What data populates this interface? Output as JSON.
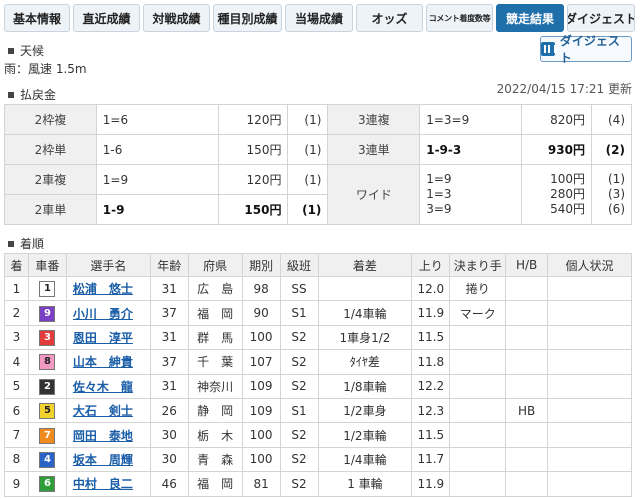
{
  "tabs": [
    {
      "label": "基本情報",
      "active": false
    },
    {
      "label": "直近成績",
      "active": false
    },
    {
      "label": "対戦成績",
      "active": false
    },
    {
      "label": "種目別成績",
      "active": false
    },
    {
      "label": "当場成績",
      "active": false
    },
    {
      "label": "オッズ",
      "active": false
    },
    {
      "label": "コメント着度数等",
      "active": false
    },
    {
      "label": "競走結果",
      "active": true
    },
    {
      "label": "ダイジェスト",
      "active": false
    }
  ],
  "weather": {
    "section": "天候",
    "text": "雨：風速 1.5m"
  },
  "digest_button": "ダイジェスト",
  "payout": {
    "section": "払戻金",
    "updated": "2022/04/15 17:21 更新",
    "rows": [
      {
        "l_label": "2枠複",
        "l_combo": "1=6",
        "l_amt": "120円",
        "l_pop": "(1)",
        "r_label": "3連複",
        "r_combo": "1=3=9",
        "r_amt": "820円",
        "r_pop": "(4)"
      },
      {
        "l_label": "2枠単",
        "l_combo": "1-6",
        "l_amt": "150円",
        "l_pop": "(1)",
        "r_label": "3連単",
        "r_combo": "1-9-3",
        "r_amt": "930円",
        "r_pop": "(2)"
      },
      {
        "l_label": "2車複",
        "l_combo": "1=9",
        "l_amt": "120円",
        "l_pop": "(1)"
      },
      {
        "l_label": "2車単",
        "l_combo": "1-9",
        "l_amt": "150円",
        "l_pop": "(1)"
      }
    ],
    "wide": {
      "label": "ワイド",
      "lines": [
        {
          "combo": "1=9",
          "amt": "100円",
          "pop": "(1)"
        },
        {
          "combo": "1=3",
          "amt": "280円",
          "pop": "(3)"
        },
        {
          "combo": "3=9",
          "amt": "540円",
          "pop": "(6)"
        }
      ]
    }
  },
  "results": {
    "section": "着順",
    "headers": [
      "着",
      "車番",
      "選手名",
      "年齢",
      "府県",
      "期別",
      "級班",
      "着差",
      "上り",
      "決まり手",
      "H/B",
      "個人状況"
    ],
    "rows": [
      {
        "rank": "1",
        "car": "1",
        "name": "松浦　悠士",
        "age": "31",
        "pref": "広　島",
        "term": "98",
        "class": "SS",
        "margin": "",
        "last": "12.0",
        "kimarite": "捲り",
        "hb": "",
        "status": ""
      },
      {
        "rank": "2",
        "car": "9",
        "name": "小川　勇介",
        "age": "37",
        "pref": "福　岡",
        "term": "90",
        "class": "S1",
        "margin": "1/4車輪",
        "last": "11.9",
        "kimarite": "マーク",
        "hb": "",
        "status": ""
      },
      {
        "rank": "3",
        "car": "3",
        "name": "恩田　淳平",
        "age": "31",
        "pref": "群　馬",
        "term": "100",
        "class": "S2",
        "margin": "1車身1/2",
        "last": "11.5",
        "kimarite": "",
        "hb": "",
        "status": ""
      },
      {
        "rank": "4",
        "car": "8",
        "name": "山本　紳貴",
        "age": "37",
        "pref": "千　葉",
        "term": "107",
        "class": "S2",
        "margin": "ﾀｲﾔ差",
        "last": "11.8",
        "kimarite": "",
        "hb": "",
        "status": ""
      },
      {
        "rank": "5",
        "car": "2",
        "name": "佐々木　龍",
        "age": "31",
        "pref": "神奈川",
        "term": "109",
        "class": "S2",
        "margin": "1/8車輪",
        "last": "12.2",
        "kimarite": "",
        "hb": "",
        "status": ""
      },
      {
        "rank": "6",
        "car": "5",
        "name": "大石　剣士",
        "age": "26",
        "pref": "静　岡",
        "term": "109",
        "class": "S1",
        "margin": "1/2車身",
        "last": "12.3",
        "kimarite": "",
        "hb": "HB",
        "status": ""
      },
      {
        "rank": "7",
        "car": "7",
        "name": "岡田　泰地",
        "age": "30",
        "pref": "栃　木",
        "term": "100",
        "class": "S2",
        "margin": "1/2車輪",
        "last": "11.5",
        "kimarite": "",
        "hb": "",
        "status": ""
      },
      {
        "rank": "8",
        "car": "4",
        "name": "坂本　周輝",
        "age": "30",
        "pref": "青　森",
        "term": "100",
        "class": "S2",
        "margin": "1/4車輪",
        "last": "11.7",
        "kimarite": "",
        "hb": "",
        "status": ""
      },
      {
        "rank": "9",
        "car": "6",
        "name": "中村　良二",
        "age": "46",
        "pref": "福　岡",
        "term": "81",
        "class": "S2",
        "margin": "1 車輪",
        "last": "11.9",
        "kimarite": "",
        "hb": "",
        "status": ""
      }
    ]
  },
  "car_colors": {
    "1": {
      "bg": "#ffffff",
      "fg": "#222222"
    },
    "2": {
      "bg": "#333333",
      "fg": "#ffffff"
    },
    "3": {
      "bg": "#e23b3b",
      "fg": "#ffffff"
    },
    "4": {
      "bg": "#2a63c7",
      "fg": "#ffffff"
    },
    "5": {
      "bg": "#f2d22c",
      "fg": "#222222"
    },
    "6": {
      "bg": "#2f9e3a",
      "fg": "#ffffff"
    },
    "7": {
      "bg": "#f08b1f",
      "fg": "#ffffff"
    },
    "8": {
      "bg": "#f29ac3",
      "fg": "#222222"
    },
    "9": {
      "bg": "#7a3fc4",
      "fg": "#ffffff"
    }
  }
}
